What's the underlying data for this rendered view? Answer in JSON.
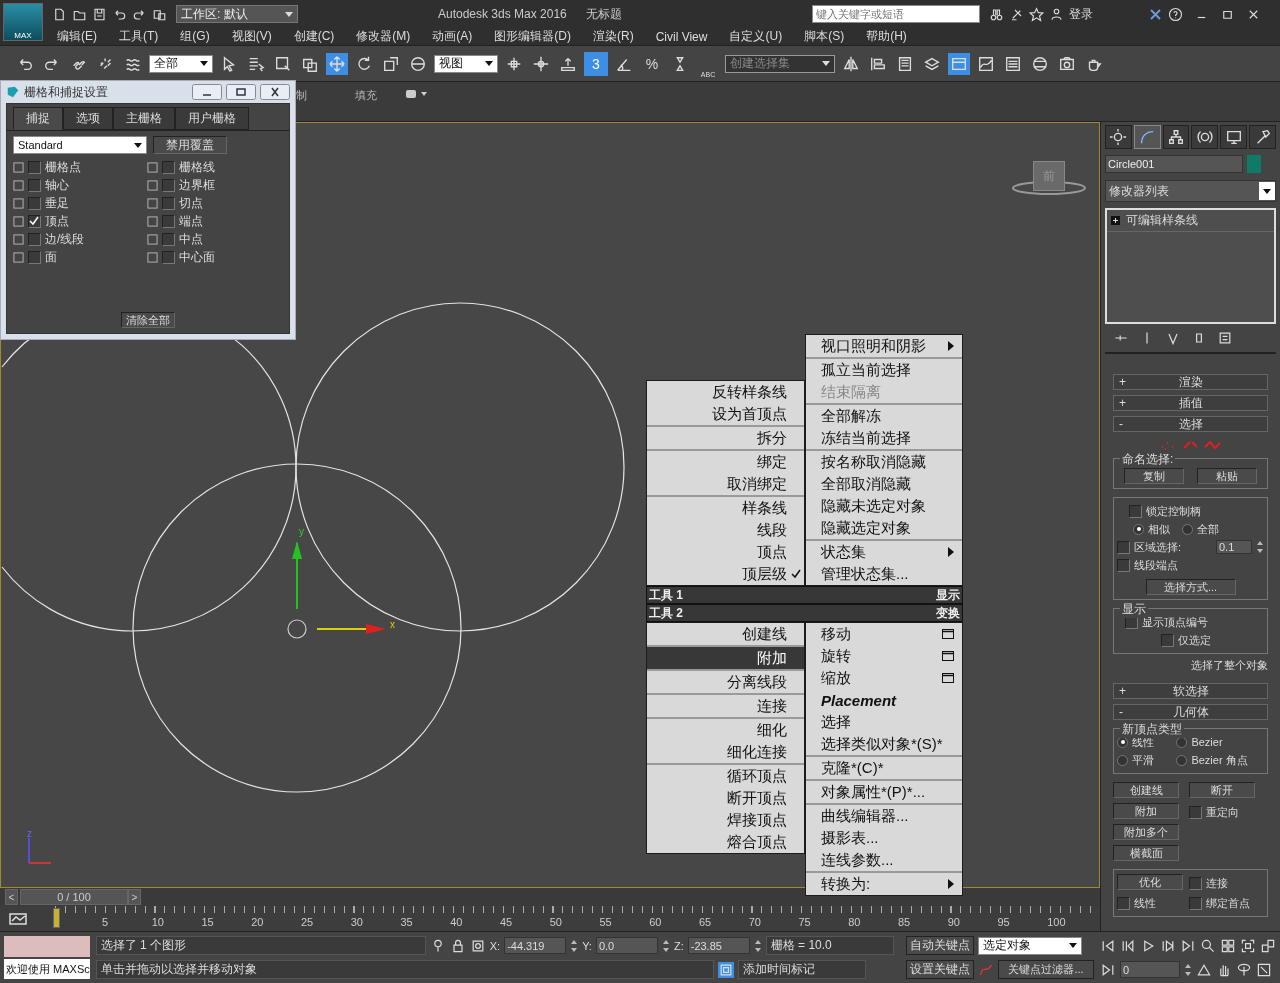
{
  "title_bar": {
    "logo": "MAX",
    "workspace": "工作区: 默认",
    "app_title": "Autodesk 3ds Max 2016",
    "document": "无标题",
    "search": {
      "placeholder": "键入关键字或短语"
    },
    "login": "登录"
  },
  "menu": [
    "编辑(E)",
    "工具(T)",
    "组(G)",
    "视图(V)",
    "创建(C)",
    "修改器(M)",
    "动画(A)",
    "图形编辑器(D)",
    "渲染(R)",
    "Civil View",
    "自定义(U)",
    "脚本(S)",
    "帮助(H)"
  ],
  "toolbar": {
    "selection_filter": "全部",
    "move_tool": {
      "on": true
    },
    "reference_coordinate": "视图",
    "snap": {
      "label": "3",
      "on": true
    },
    "percent_snap": "%",
    "named_selection_icon_text": "ABC",
    "selection_set": "创建选择集",
    "ribbon_toggle": {
      "on": true
    }
  },
  "ribbon": [
    "制",
    "填充"
  ],
  "snap_dialog": {
    "title": "栅格和捕捉设置",
    "tabs": [
      {
        "label": "捕捉",
        "selected": true
      },
      {
        "label": "选项",
        "selected": false
      },
      {
        "label": "主栅格",
        "selected": false
      },
      {
        "label": "用户栅格",
        "selected": false
      }
    ],
    "preset": "Standard",
    "override_button": "禁用覆盖",
    "options": [
      {
        "label": "栅格点",
        "checked": false
      },
      {
        "label": "栅格线",
        "checked": false
      },
      {
        "label": "轴心",
        "checked": false
      },
      {
        "label": "边界框",
        "checked": false
      },
      {
        "label": "垂足",
        "checked": false
      },
      {
        "label": "切点",
        "checked": false
      },
      {
        "label": "顶点",
        "checked": true
      },
      {
        "label": "端点",
        "checked": false
      },
      {
        "label": "边/线段",
        "checked": false
      },
      {
        "label": "中点",
        "checked": false
      },
      {
        "label": "面",
        "checked": false
      },
      {
        "label": "中心面",
        "checked": false
      }
    ],
    "clear_button": "清除全部"
  },
  "viewport": {
    "gizmo": {
      "x_label": "x",
      "y_label": "y"
    },
    "world_axis_label": "z",
    "viewcube_label": "前"
  },
  "quad": {
    "top_left": [
      [
        {
          "label": "反转样条线",
          "selected": false
        },
        {
          "label": "设为首顶点",
          "selected": false
        }
      ],
      [
        {
          "label": "拆分",
          "selected": false
        }
      ],
      [
        {
          "label": "绑定",
          "selected": false
        },
        {
          "label": "取消绑定",
          "selected": false
        }
      ],
      [
        {
          "label": "样条线",
          "selected": false
        },
        {
          "label": "线段",
          "selected": false
        },
        {
          "label": "顶点",
          "selected": false
        },
        {
          "label": "顶层级",
          "kind": "checked",
          "selected": false
        }
      ]
    ],
    "top_right": [
      [
        {
          "label": "视口照明和阴影",
          "kind": "submenu",
          "selected": false
        }
      ],
      [
        {
          "label": "孤立当前选择",
          "selected": false
        },
        {
          "label": "结束隔离",
          "kind": "disabled",
          "selected": false
        }
      ],
      [
        {
          "label": "全部解冻",
          "selected": false
        },
        {
          "label": "冻结当前选择",
          "selected": false
        }
      ],
      [
        {
          "label": "按名称取消隐藏",
          "selected": false
        },
        {
          "label": "全部取消隐藏",
          "selected": false
        },
        {
          "label": "隐藏未选定对象",
          "selected": false
        },
        {
          "label": "隐藏选定对象",
          "selected": false
        }
      ],
      [
        {
          "label": "状态集",
          "kind": "submenu",
          "selected": false
        },
        {
          "label": "管理状态集...",
          "selected": false
        }
      ]
    ],
    "headers": [
      {
        "left": "工具 1",
        "right": "显示"
      },
      {
        "left": "工具 2",
        "right": "变换"
      }
    ],
    "bottom_left": [
      [
        {
          "label": "创建线",
          "selected": false
        }
      ],
      [
        {
          "label": "附加",
          "selected": true
        }
      ],
      [
        {
          "label": "分离线段",
          "selected": false
        }
      ],
      [
        {
          "label": "连接",
          "selected": false
        }
      ],
      [
        {
          "label": "细化",
          "selected": false
        },
        {
          "label": "细化连接",
          "selected": false
        }
      ],
      [
        {
          "label": "循环顶点",
          "selected": false
        },
        {
          "label": "断开顶点",
          "selected": false
        },
        {
          "label": "焊接顶点",
          "selected": false
        },
        {
          "label": "熔合顶点",
          "selected": false
        }
      ]
    ],
    "bottom_right": [
      [
        {
          "label": "移动",
          "kind": "option",
          "selected": false
        },
        {
          "label": "旋转",
          "kind": "option",
          "selected": false
        },
        {
          "label": "缩放",
          "kind": "option",
          "selected": false
        },
        {
          "label": "Placement",
          "kind": "emphasis",
          "selected": false
        },
        {
          "label": "选择",
          "selected": false
        },
        {
          "label": "选择类似对象*(S)*",
          "selected": false
        }
      ],
      [
        {
          "label": "克隆*(C)*",
          "selected": false
        }
      ],
      [
        {
          "label": "对象属性*(P)*...",
          "selected": false
        }
      ],
      [
        {
          "label": "曲线编辑器...",
          "selected": false
        },
        {
          "label": "摄影表...",
          "selected": false
        },
        {
          "label": "连线参数...",
          "selected": false
        }
      ],
      [
        {
          "label": "转换为:",
          "kind": "submenu",
          "selected": false
        }
      ]
    ]
  },
  "command_panel": {
    "tabs": [
      {
        "kind": "create",
        "selected": false
      },
      {
        "kind": "modify",
        "selected": true
      },
      {
        "kind": "hierarchy",
        "selected": false
      },
      {
        "kind": "motion",
        "selected": false
      },
      {
        "kind": "display",
        "selected": false
      },
      {
        "kind": "utilities",
        "selected": false
      }
    ],
    "object": {
      "name": "Circle001",
      "color": "#0f7a66"
    },
    "modifier_list": "修改器列表",
    "stack": [
      "可编辑样条线"
    ],
    "rollouts": [
      {
        "sign": "+",
        "title": "渲染"
      },
      {
        "sign": "+",
        "title": "插值"
      },
      {
        "sign": "-",
        "title": "选择",
        "kind": "selection",
        "content": {
          "named_selection": {
            "legend": "命名选择:",
            "buttons": [
              "复制",
              "粘贴"
            ]
          },
          "lock_handles": {
            "label": "锁定控制柄",
            "checked": false
          },
          "handle_mode": [
            {
              "label": "相似",
              "selected": true
            },
            {
              "label": "全部",
              "selected": false
            }
          ],
          "area_selection": {
            "label": "区域选择:",
            "checked": false,
            "value": "0.1"
          },
          "segment_end": {
            "label": "线段端点",
            "checked": false
          },
          "select_by": "选择方式...",
          "display": {
            "legend": "显示",
            "show_numbers": {
              "label": "显示顶点编号",
              "checked": false
            },
            "selected_only": {
              "label": "仅选定",
              "checked": false
            }
          },
          "status": "选择了整个对象"
        }
      },
      {
        "sign": "+",
        "title": "软选择"
      },
      {
        "sign": "-",
        "title": "几何体",
        "kind": "geometry",
        "content": {
          "vertex_type": {
            "legend": "新顶点类型",
            "options": [
              {
                "label": "线性",
                "selected": true
              },
              {
                "label": "Bezier",
                "selected": false
              },
              {
                "label": "平滑",
                "selected": false
              },
              {
                "label": "Bezier 角点",
                "selected": false
              }
            ]
          },
          "buttons": [
            "创建线",
            "断开",
            "附加",
            "附加多个",
            "横截面"
          ],
          "reorient": {
            "label": "重定向",
            "checked": false
          },
          "refine": {
            "button": "优化",
            "options": [
              {
                "label": "连接",
                "checked": false
              },
              {
                "label": "线性",
                "checked": false
              },
              {
                "label": "绑定首点",
                "checked": false
              }
            ]
          }
        }
      }
    ]
  },
  "time_slider": {
    "prev": "<",
    "position": "0 / 100",
    "next": ">"
  },
  "trackbar": {
    "labels": [
      "5",
      "10",
      "15",
      "20",
      "25",
      "30",
      "35",
      "40",
      "45",
      "50",
      "55",
      "60",
      "65",
      "70",
      "75",
      "80",
      "85",
      "90",
      "95",
      "100"
    ]
  },
  "status_bar": {
    "listener": "欢迎使用 MAXSc",
    "selection_info": "选择了 1 个图形",
    "prompt": "单击并拖动以选择并移动对象",
    "x": {
      "label": "X:",
      "value": "-44.319"
    },
    "y": {
      "label": "Y:",
      "value": "0.0"
    },
    "z": {
      "label": "Z:",
      "value": "-23.85"
    },
    "grid": "栅格 = 10.0",
    "time_tag": "添加时间标记",
    "auto_key": "自动关键点",
    "set_key": "设置关键点",
    "key_mode": "选定对象",
    "key_filters": "关键点过滤器...",
    "frame": "0"
  }
}
